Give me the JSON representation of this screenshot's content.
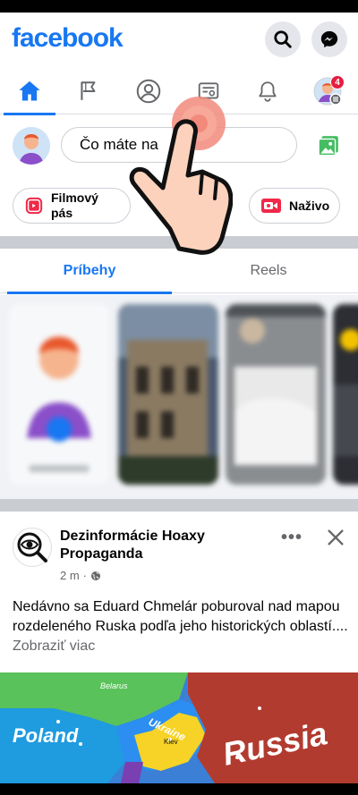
{
  "app": {
    "logo": "facebook",
    "accent": "#1877f2"
  },
  "header": {
    "search_icon": "search-icon",
    "messenger_icon": "messenger-icon"
  },
  "nav": {
    "items": [
      {
        "name": "home",
        "icon": "home-icon",
        "active": true
      },
      {
        "name": "pages",
        "icon": "flag-icon",
        "active": false
      },
      {
        "name": "profile",
        "icon": "person-icon",
        "active": false
      },
      {
        "name": "news",
        "icon": "newsfeed-icon",
        "active": false
      },
      {
        "name": "notifications",
        "icon": "bell-icon",
        "active": false
      },
      {
        "name": "menu",
        "icon": "avatar-menu-icon",
        "active": false
      }
    ],
    "menu_badge": "4"
  },
  "composer": {
    "placeholder": "Čo máte na mysli?",
    "visible_text": "Čo máte na"
  },
  "chips": {
    "reel_line1": "Filmový",
    "reel_line2": "pás",
    "live": "Naživo"
  },
  "tabs": {
    "stories": "Príbehy",
    "reels": "Reels"
  },
  "post": {
    "author_line1": "Dezinformácie Hoaxy",
    "author_line2": "Propaganda",
    "time": "2 m",
    "text": "Nedávno sa Eduard Chmelár poburoval nad mapou rozdeleného  Ruska podľa jeho historických oblastí.... ",
    "more": "Zobraziť viac"
  },
  "map": {
    "poland": "Poland",
    "ukraine": "Ukraine",
    "russia": "Russia",
    "belarus": "Belarus",
    "kiev": "Kiev"
  }
}
